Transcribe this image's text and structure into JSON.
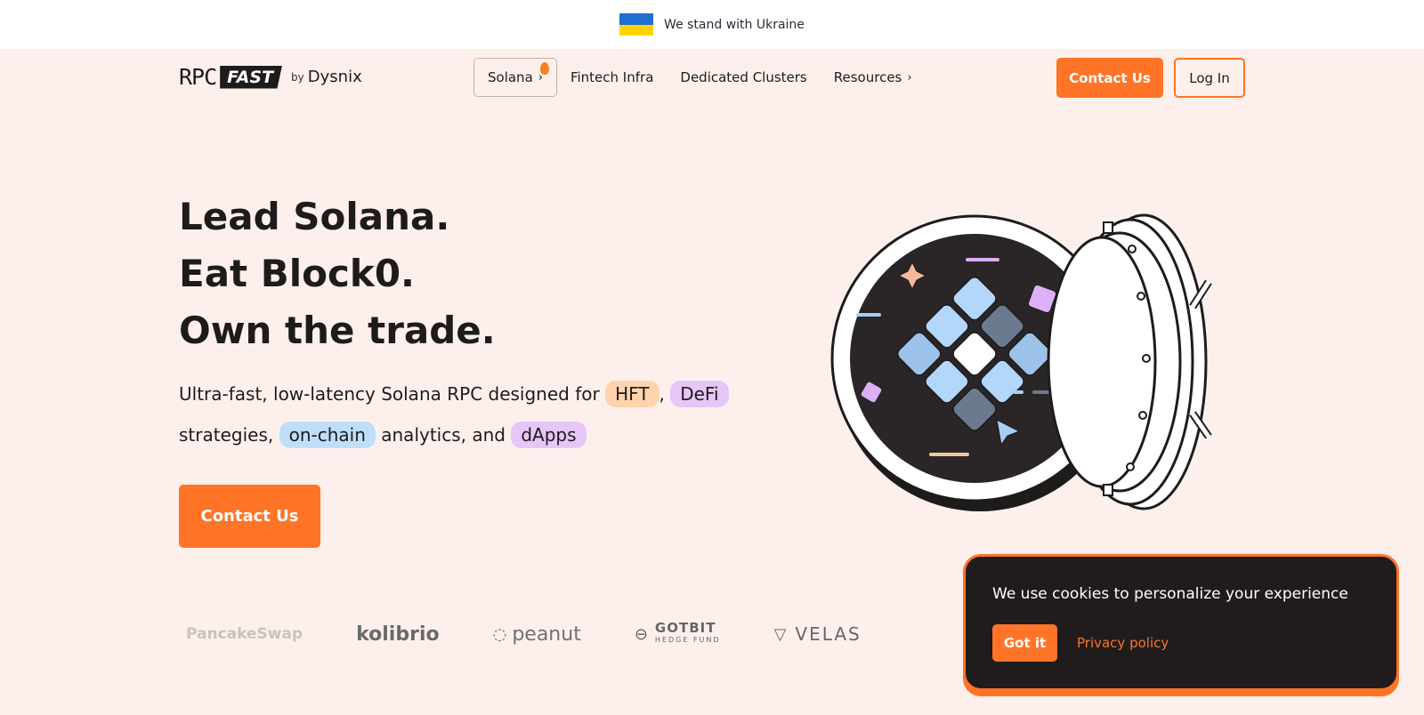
{
  "banner": {
    "text": "We stand with Ukraine",
    "flag_colors": [
      "#1f6fd1",
      "#ffd400"
    ]
  },
  "logo": {
    "rpc": "RPC",
    "fast": "FAST",
    "by": "by",
    "company": "Dysnix"
  },
  "nav": {
    "items": [
      {
        "label": "Solana"
      },
      {
        "label": "Fintech Infra"
      },
      {
        "label": "Dedicated Clusters"
      },
      {
        "label": "Resources"
      }
    ],
    "contact_label": "Contact Us",
    "login_label": "Log In"
  },
  "hero": {
    "title_lines": [
      "Lead Solana.",
      "Eat Block0.",
      "Own the trade."
    ],
    "sub": {
      "part1": "Ultra-fast, low-latency Solana RPC designed for",
      "tag_hft": "HFT",
      "part2": ",",
      "tag_defi": "DeFi",
      "part3": "strategies,",
      "tag_onchain": "on-chain",
      "part4": "analytics, and",
      "tag_dapps": "dApps"
    },
    "cta_label": "Contact Us"
  },
  "partners": [
    "PancakeSwap",
    "kolibrio",
    "peanut",
    "GOTBIT",
    "HEDGE FUND",
    "VELAS"
  ],
  "cookie": {
    "text": "We use cookies to personalize your experience",
    "accept_label": "Got it",
    "policy_label": "Privacy policy"
  },
  "colors": {
    "accent": "#ff7426",
    "background": "#fdf0ec",
    "dark": "#201c1e"
  }
}
